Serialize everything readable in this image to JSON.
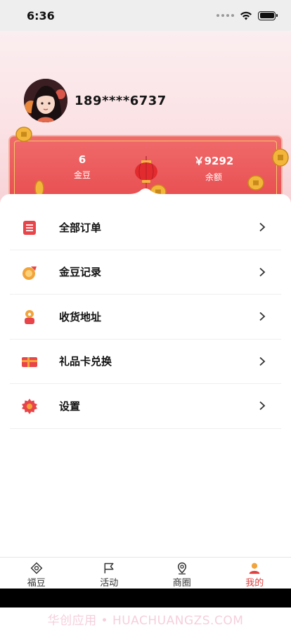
{
  "status_bar": {
    "time": "6:36"
  },
  "profile": {
    "phone": "189****6737"
  },
  "card": {
    "left_value": "6",
    "left_label": "金豆",
    "right_value": "￥9292",
    "right_label": "余额"
  },
  "menu": [
    {
      "label": "全部订单",
      "icon": "order-list-icon"
    },
    {
      "label": "金豆记录",
      "icon": "bean-record-icon"
    },
    {
      "label": "收货地址",
      "icon": "address-icon"
    },
    {
      "label": "礼品卡兑换",
      "icon": "gift-card-icon"
    },
    {
      "label": "设置",
      "icon": "settings-icon"
    }
  ],
  "tabbar": [
    {
      "label": "福豆",
      "icon": "bean-tab-icon",
      "active": false
    },
    {
      "label": "活动",
      "icon": "flag-tab-icon",
      "active": false
    },
    {
      "label": "商圈",
      "icon": "location-tab-icon",
      "active": false
    },
    {
      "label": "我的",
      "icon": "profile-tab-icon",
      "active": true
    }
  ],
  "colors": {
    "accent": "#e2403e",
    "card": "#ea5558",
    "hero": "#fbe1e4"
  },
  "watermark": "华创应用 • HUACHUANGZS.COM"
}
